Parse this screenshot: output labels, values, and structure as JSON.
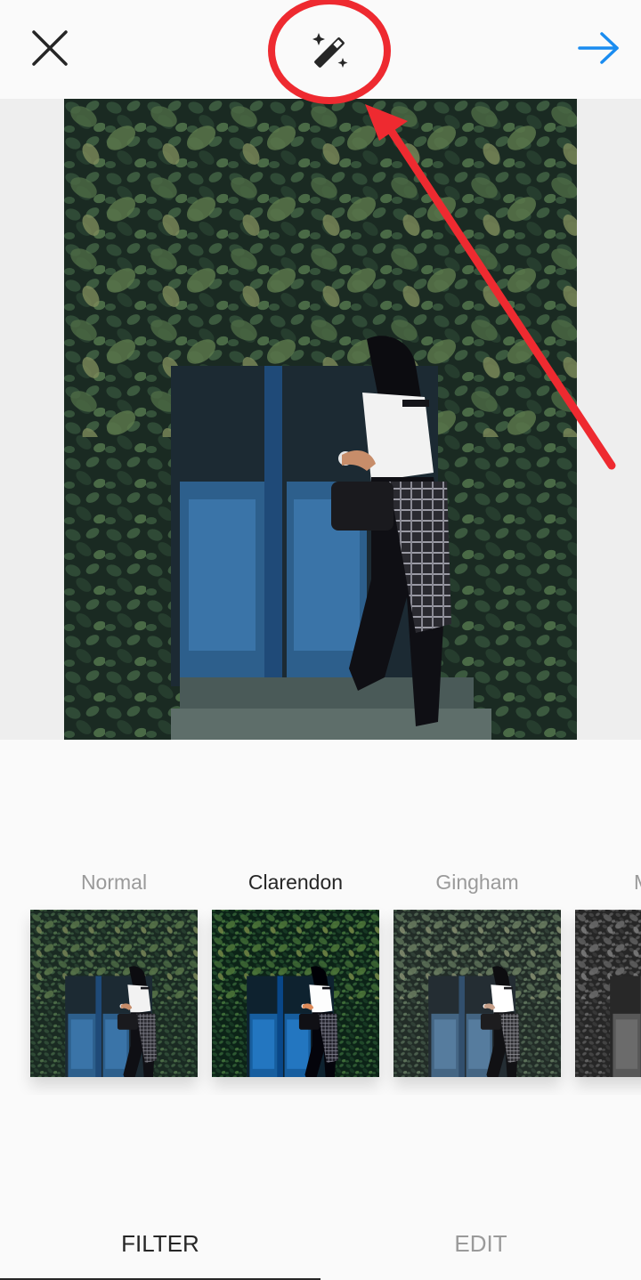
{
  "header": {
    "close_icon": "close-icon",
    "magic_icon": "magic-wand-icon",
    "next_icon": "arrow-right-icon",
    "next_color": "#1a8cf0"
  },
  "photo": {
    "description_icon": "photo-preview"
  },
  "filters": [
    {
      "label": "Normal",
      "selected": false
    },
    {
      "label": "Clarendon",
      "selected": true
    },
    {
      "label": "Gingham",
      "selected": false
    },
    {
      "label": "M",
      "selected": false
    }
  ],
  "tabs": {
    "filter_label": "FILTER",
    "edit_label": "EDIT",
    "active": "FILTER"
  },
  "annotation": {
    "color": "#ee2a30"
  }
}
